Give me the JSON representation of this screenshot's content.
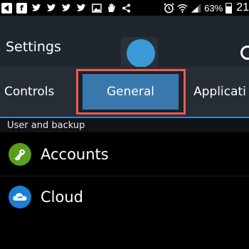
{
  "status_bar": {
    "notification_icons": [
      "back-arrow-icon",
      "facebook-icon",
      "twitter-icon",
      "twitter-icon",
      "twitter-icon",
      "twitter-icon",
      "image-icon",
      "hand-icon",
      "share-icon"
    ],
    "battery": "63%",
    "battery_level": 0.63,
    "time": "21"
  },
  "header": {
    "title": "Settings",
    "search_icon": "search-icon",
    "assistive_touch": "assistive-touch-circle"
  },
  "tabs": [
    {
      "label": "Controls",
      "selected": false
    },
    {
      "label": "General",
      "selected": true
    },
    {
      "label": "Applicati",
      "selected": false
    }
  ],
  "section": {
    "label": "User and backup"
  },
  "list": [
    {
      "label": "Accounts",
      "icon": "key-icon",
      "color": "#5b9e1e"
    },
    {
      "label": "Cloud",
      "icon": "cloud-icon",
      "color": "#1c7fd1"
    }
  ],
  "colors": {
    "action_bar": "#1f262d",
    "tab_bar": "#262d35",
    "selected_tab": "#3978ad",
    "highlight_outline": "#f05a4e",
    "assist_circle": "#3a9bd6"
  }
}
